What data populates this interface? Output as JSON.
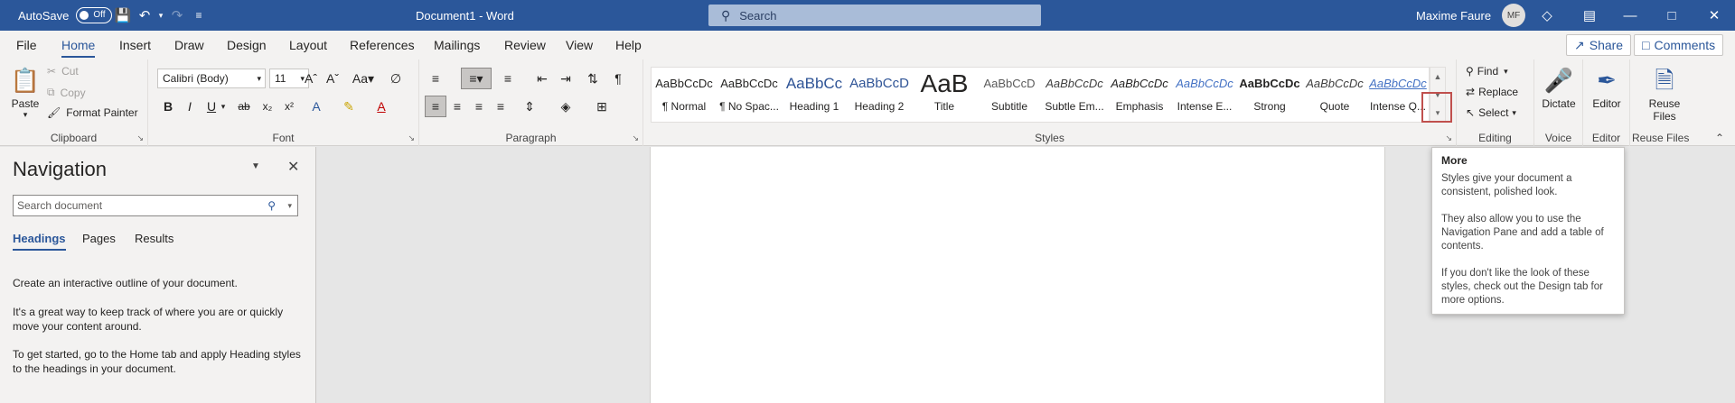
{
  "titlebar": {
    "autosave_label": "AutoSave",
    "autosave_state": "Off",
    "doc_title": "Document1 - Word",
    "search_placeholder": "Search",
    "user_name": "Maxime Faure",
    "user_initials": "MF",
    "accent_color": "#2b579a"
  },
  "tabs": [
    "File",
    "Home",
    "Insert",
    "Draw",
    "Design",
    "Layout",
    "References",
    "Mailings",
    "Review",
    "View",
    "Help"
  ],
  "active_tab": "Home",
  "share_label": "Share",
  "comments_label": "Comments",
  "clipboard": {
    "paste": "Paste",
    "cut": "Cut",
    "copy": "Copy",
    "format_painter": "Format Painter",
    "group": "Clipboard"
  },
  "font": {
    "name": "Calibri (Body)",
    "size": "11",
    "group": "Font"
  },
  "paragraph": {
    "group": "Paragraph"
  },
  "styles": {
    "group": "Styles",
    "items": [
      {
        "preview": "AaBbCcDc",
        "name": "¶ Normal"
      },
      {
        "preview": "AaBbCcDc",
        "name": "¶ No Spac..."
      },
      {
        "preview": "AaBbCc",
        "name": "Heading 1"
      },
      {
        "preview": "AaBbCcD",
        "name": "Heading 2"
      },
      {
        "preview": "AaB",
        "name": "Title"
      },
      {
        "preview": "AaBbCcD",
        "name": "Subtitle"
      },
      {
        "preview": "AaBbCcDc",
        "name": "Subtle Em..."
      },
      {
        "preview": "AaBbCcDc",
        "name": "Emphasis"
      },
      {
        "preview": "AaBbCcDc",
        "name": "Intense E..."
      },
      {
        "preview": "AaBbCcDc",
        "name": "Strong"
      },
      {
        "preview": "AaBbCcDc",
        "name": "Quote"
      },
      {
        "preview": "AaBbCcDc",
        "name": "Intense Q..."
      }
    ]
  },
  "editing": {
    "find": "Find",
    "replace": "Replace",
    "select": "Select",
    "group": "Editing"
  },
  "voice": {
    "dictate": "Dictate",
    "group": "Voice"
  },
  "editor": {
    "label": "Editor",
    "group": "Editor"
  },
  "reuse": {
    "label_line1": "Reuse",
    "label_line2": "Files",
    "group": "Reuse Files"
  },
  "navigation": {
    "title": "Navigation",
    "search_placeholder": "Search document",
    "tabs": [
      "Headings",
      "Pages",
      "Results"
    ],
    "active_tab": "Headings",
    "p1": "Create an interactive outline of your document.",
    "p2": "It's a great way to keep track of where you are or quickly move your content around.",
    "p3": "To get started, go to the Home tab and apply Heading styles to the headings in your document."
  },
  "tooltip": {
    "title": "More",
    "p1": "Styles give your document a consistent, polished look.",
    "p2": "They also allow you to use the Navigation Pane and add a table of contents.",
    "p3": "If you don't like the look of these styles, check out the Design tab for more options."
  }
}
